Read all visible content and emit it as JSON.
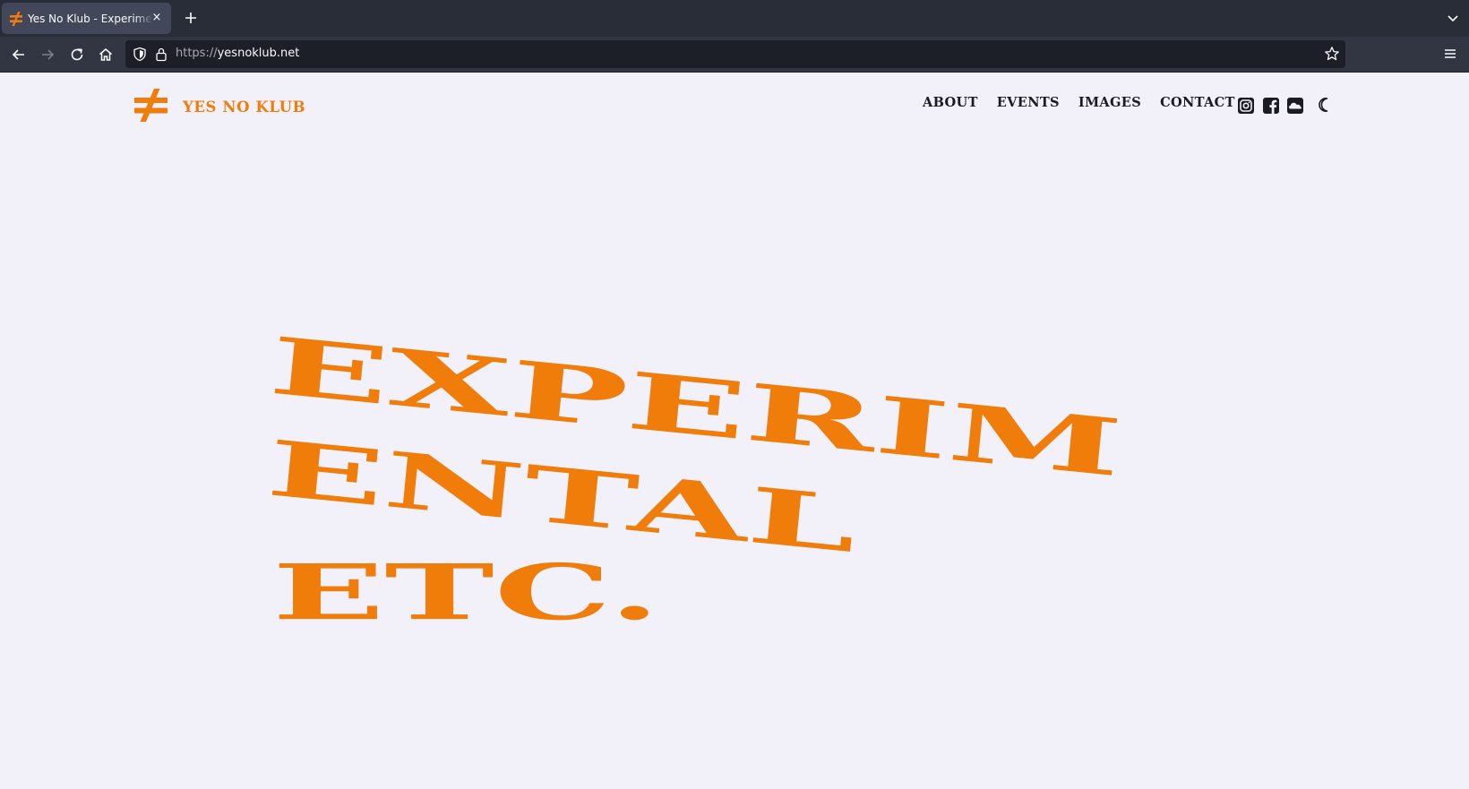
{
  "browser": {
    "tab_title": "Yes No Klub - Experimental",
    "tab_close": "×",
    "url_protocol": "https://",
    "url_host": "yesnoklub.net"
  },
  "site": {
    "logo_text": "YES NO KLUB",
    "nav": [
      "ABOUT",
      "EVENTS",
      "IMAGES",
      "CONTACT"
    ],
    "social_icons": [
      "instagram-icon",
      "facebook-icon",
      "soundcloud-icon"
    ],
    "theme_toggle_icon": "moon-icon",
    "accent_color": "#f07c0a",
    "text_color": "#1b1b22",
    "background_color": "#f2f0f8"
  },
  "hero": {
    "lines": [
      "EXPERIM",
      "ENTAL",
      "ETC."
    ]
  }
}
